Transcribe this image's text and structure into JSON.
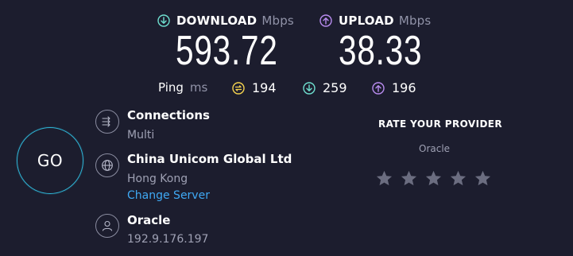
{
  "download": {
    "label": "DOWNLOAD",
    "unit": "Mbps",
    "value": "593.72",
    "icon": "download-arrow-icon",
    "color": "#6fe0d0"
  },
  "upload": {
    "label": "UPLOAD",
    "unit": "Mbps",
    "value": "38.33",
    "icon": "upload-arrow-icon",
    "color": "#b98cf0"
  },
  "ping": {
    "label": "Ping",
    "unit": "ms",
    "idle": "194",
    "download": "259",
    "upload": "196",
    "idle_color": "#f5d34f",
    "download_color": "#6fe0d0",
    "upload_color": "#b98cf0"
  },
  "go_button": {
    "label": "GO",
    "ring_color": "#2fb3d4"
  },
  "connections": {
    "title": "Connections",
    "value": "Multi",
    "icon": "connections-icon"
  },
  "server": {
    "title": "China Unicom Global Ltd",
    "location": "Hong Kong",
    "change_link": "Change Server",
    "icon": "globe-icon",
    "link_color": "#3fa9f5"
  },
  "isp": {
    "title": "Oracle",
    "ip": "192.9.176.197",
    "icon": "user-icon"
  },
  "rate": {
    "title": "RATE YOUR PROVIDER",
    "provider": "Oracle",
    "star_count": 5,
    "rating": 0,
    "star_color": "#6b6d80"
  }
}
